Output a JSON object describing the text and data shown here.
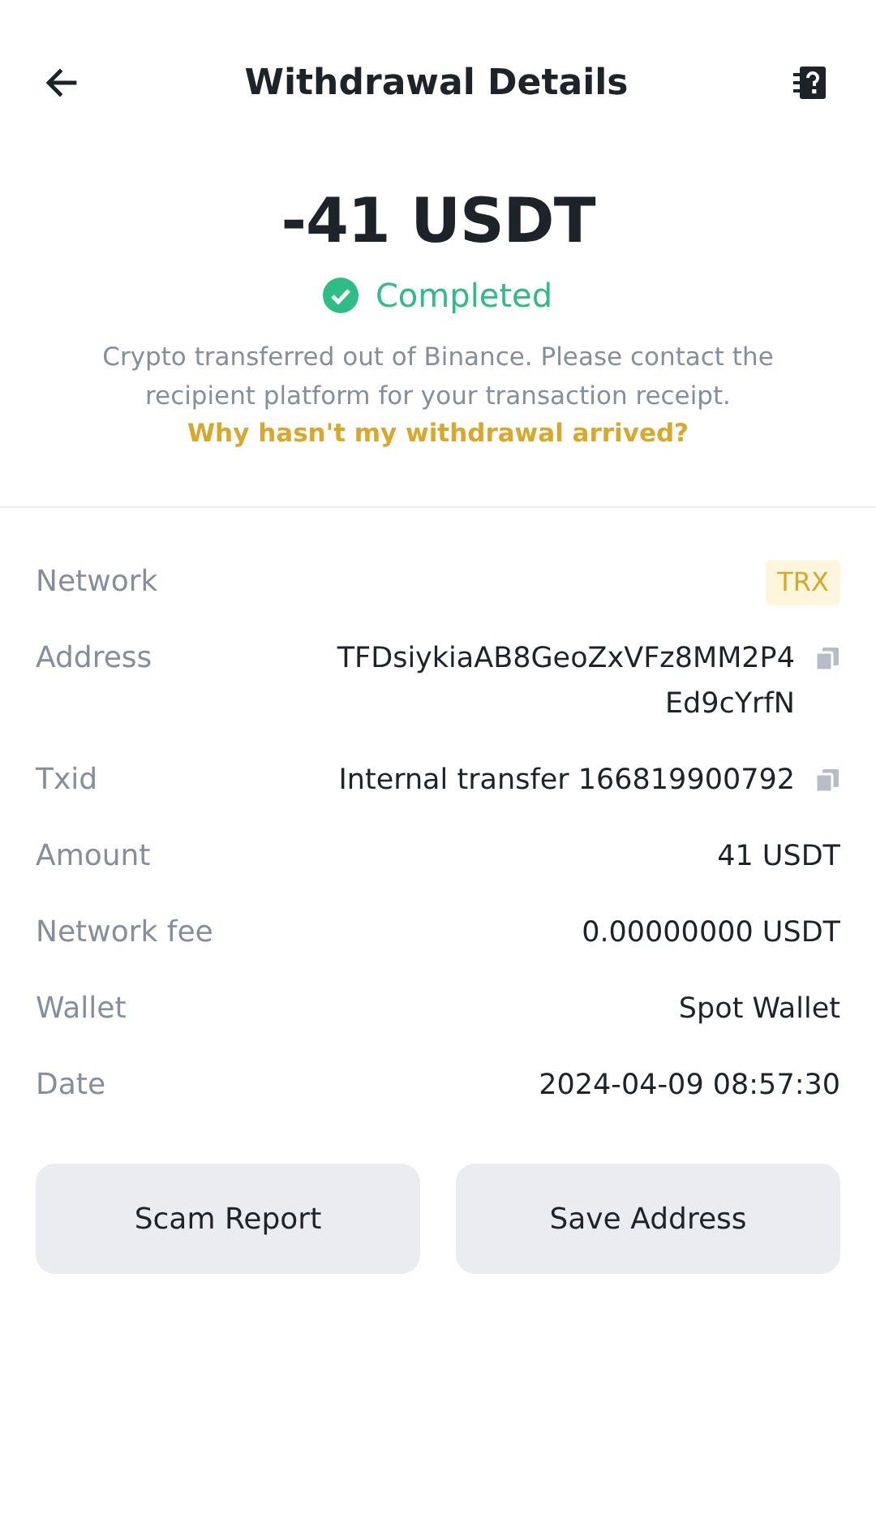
{
  "header": {
    "title": "Withdrawal Details"
  },
  "summary": {
    "amount": "-41 USDT",
    "status": "Completed",
    "note": "Crypto transferred out of Binance. Please contact the recipient platform for your transaction receipt.",
    "link": "Why hasn't my withdrawal arrived?"
  },
  "details": [
    {
      "label": "Network",
      "value": "TRX",
      "kind": "tag"
    },
    {
      "label": "Address",
      "value": "TFDsiykiaAB8GeoZxVFz8MM2P4Ed9cYrfN",
      "kind": "copy"
    },
    {
      "label": "Txid",
      "value": "Internal transfer 166819900792",
      "kind": "copy"
    },
    {
      "label": "Amount",
      "value": "41 USDT",
      "kind": "text"
    },
    {
      "label": "Network fee",
      "value": "0.00000000 USDT",
      "kind": "text"
    },
    {
      "label": "Wallet",
      "value": "Spot Wallet",
      "kind": "text"
    },
    {
      "label": "Date",
      "value": "2024-04-09 08:57:30",
      "kind": "text"
    }
  ],
  "buttons": [
    "Scam Report",
    "Save Address"
  ]
}
